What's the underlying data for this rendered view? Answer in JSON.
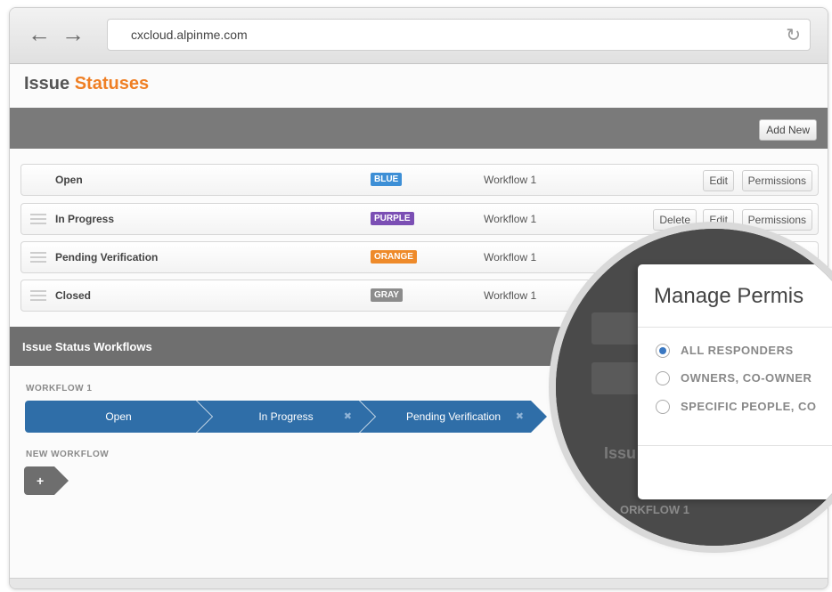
{
  "browser": {
    "url": "cxcloud.alpinme.com"
  },
  "page": {
    "title_prefix": "Issue",
    "title_accent": "Statuses"
  },
  "toolbar": {
    "add_new_label": "Add New"
  },
  "statuses": [
    {
      "name": "Open",
      "color_label": "BLUE",
      "color": "#3d8fd6",
      "workflow": "Workflow 1",
      "buttons": [
        "Edit",
        "Permissions"
      ]
    },
    {
      "name": "In Progress",
      "color_label": "PURPLE",
      "color": "#7b4fb4",
      "workflow": "Workflow 1",
      "buttons": [
        "Delete",
        "Edit",
        "Permissions"
      ]
    },
    {
      "name": "Pending Verification",
      "color_label": "ORANGE",
      "color": "#ee8a2a",
      "workflow": "Workflow 1",
      "buttons": []
    },
    {
      "name": "Closed",
      "color_label": "GRAY",
      "color": "#8c8c8c",
      "workflow": "Workflow 1",
      "buttons": []
    }
  ],
  "workflows_section": {
    "title": "Issue Status Workflows",
    "workflow_label": "WORKFLOW 1",
    "steps": [
      "Open",
      "In Progress",
      "Pending Verification"
    ],
    "new_workflow_label": "NEW WORKFLOW",
    "new_step_symbol": "+"
  },
  "magnifier": {
    "bg_issue_text": "Issu",
    "bg_workflow_text": "ORKFLOW 1",
    "modal": {
      "title": "Manage Permis",
      "options": [
        {
          "label": "ALL RESPONDERS",
          "checked": true
        },
        {
          "label": "OWNERS, CO-OWNER",
          "checked": false
        },
        {
          "label": "SPECIFIC PEOPLE, CO",
          "checked": false
        }
      ]
    }
  },
  "icons": {
    "back": "arrow-left-icon",
    "forward": "arrow-right-icon",
    "reload": "reload-icon",
    "drag_handle": "drag-handle-icon",
    "remove_step": "close-icon"
  }
}
